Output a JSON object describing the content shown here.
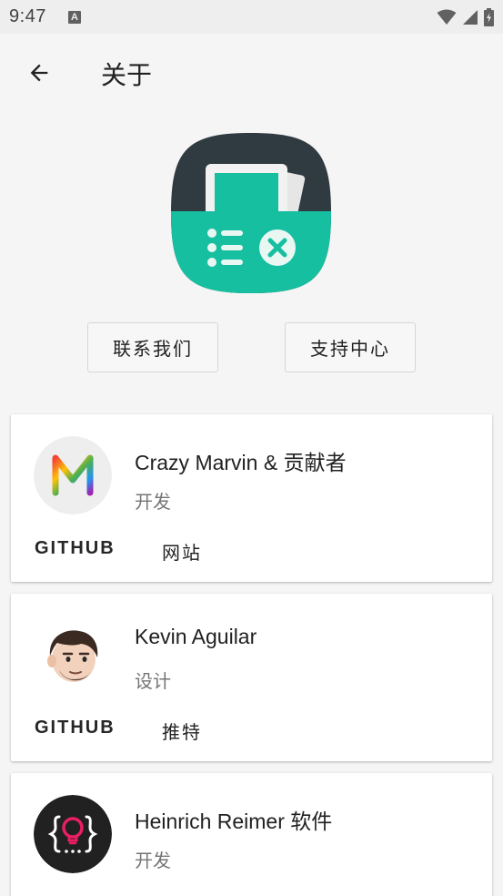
{
  "status_bar": {
    "time": "9:47",
    "notification_letter": "A"
  },
  "toolbar": {
    "title": "关于"
  },
  "buttons": {
    "contact": "联系我们",
    "support": "支持中心"
  },
  "contributors": [
    {
      "name": "Crazy Marvin & 贡献者",
      "role": "开发",
      "action_1": "GITHUB",
      "action_2": "网站"
    },
    {
      "name": "Kevin Aguilar",
      "role": "设计",
      "action_1": "GITHUB",
      "action_2": "推特"
    },
    {
      "name": "Heinrich Reimer 软件",
      "role": "开发"
    }
  ],
  "colors": {
    "logo_teal": "#16bfa0",
    "logo_dark": "#2f3a41",
    "background": "#f5f5f5"
  }
}
